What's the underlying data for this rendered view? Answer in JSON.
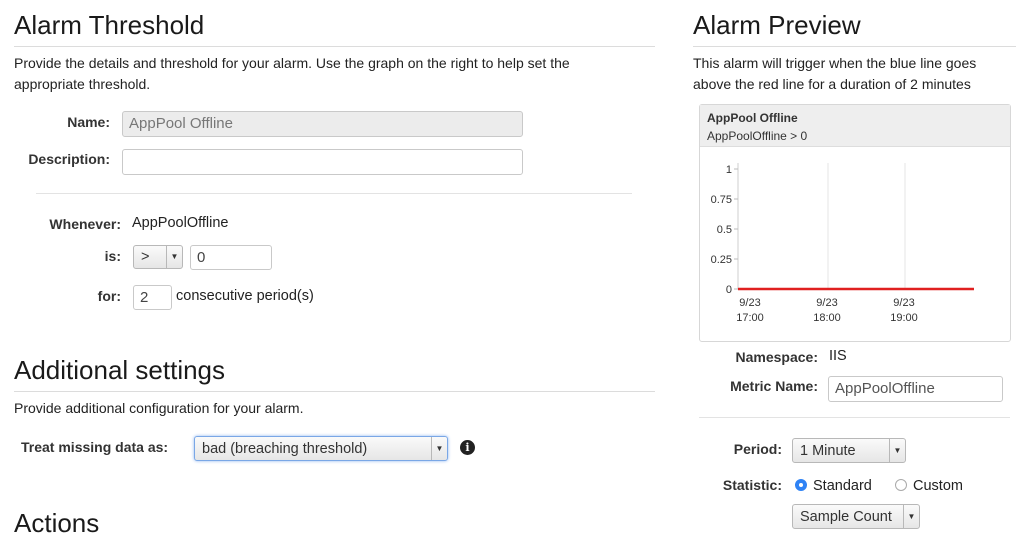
{
  "threshold": {
    "title": "Alarm Threshold",
    "description": "Provide the details and threshold for your alarm. Use the graph on the right to help set the appropriate threshold.",
    "name_label": "Name:",
    "name_value": "AppPool Offline",
    "description_label": "Description:",
    "description_value": "",
    "whenever_label": "Whenever:",
    "whenever_value": "AppPoolOffline",
    "is_label": "is:",
    "operator": ">",
    "threshold_value": "0",
    "for_label": "for:",
    "periods_value": "2",
    "periods_suffix": "consecutive period(s)"
  },
  "additional": {
    "title": "Additional settings",
    "description": "Provide additional configuration for your alarm.",
    "missing_label": "Treat missing data as:",
    "missing_value": "bad (breaching threshold)",
    "info_icon": "info-icon"
  },
  "actions": {
    "title": "Actions"
  },
  "preview": {
    "title": "Alarm Preview",
    "description": "This alarm will trigger when the blue line goes above the red line for a duration of 2 minutes",
    "chart_title": "AppPool Offline",
    "chart_subtitle": "AppPoolOffline > 0",
    "namespace_label": "Namespace:",
    "namespace_value": "IIS",
    "metric_label": "Metric Name:",
    "metric_value": "AppPoolOffline",
    "period_label": "Period:",
    "period_value": "1 Minute",
    "statistic_label": "Statistic:",
    "standard_label": "Standard",
    "custom_label": "Custom",
    "statistic_value": "Sample Count"
  },
  "colors": {
    "threshold_line": "#e02020",
    "radio_selected": "#2f83f5"
  },
  "chart_data": {
    "type": "line",
    "title": "AppPool Offline",
    "subtitle": "AppPoolOffline > 0",
    "xlabel": "",
    "ylabel": "",
    "ylim": [
      0,
      1
    ],
    "y_ticks": [
      "1",
      "0.75",
      "0.5",
      "0.25",
      "0"
    ],
    "x_ticks": [
      {
        "date": "9/23",
        "time": "17:00"
      },
      {
        "date": "9/23",
        "time": "18:00"
      },
      {
        "date": "9/23",
        "time": "19:00"
      }
    ],
    "series": [
      {
        "values": [
          0,
          0
        ],
        "color": "#e02020"
      }
    ],
    "grid": true
  }
}
